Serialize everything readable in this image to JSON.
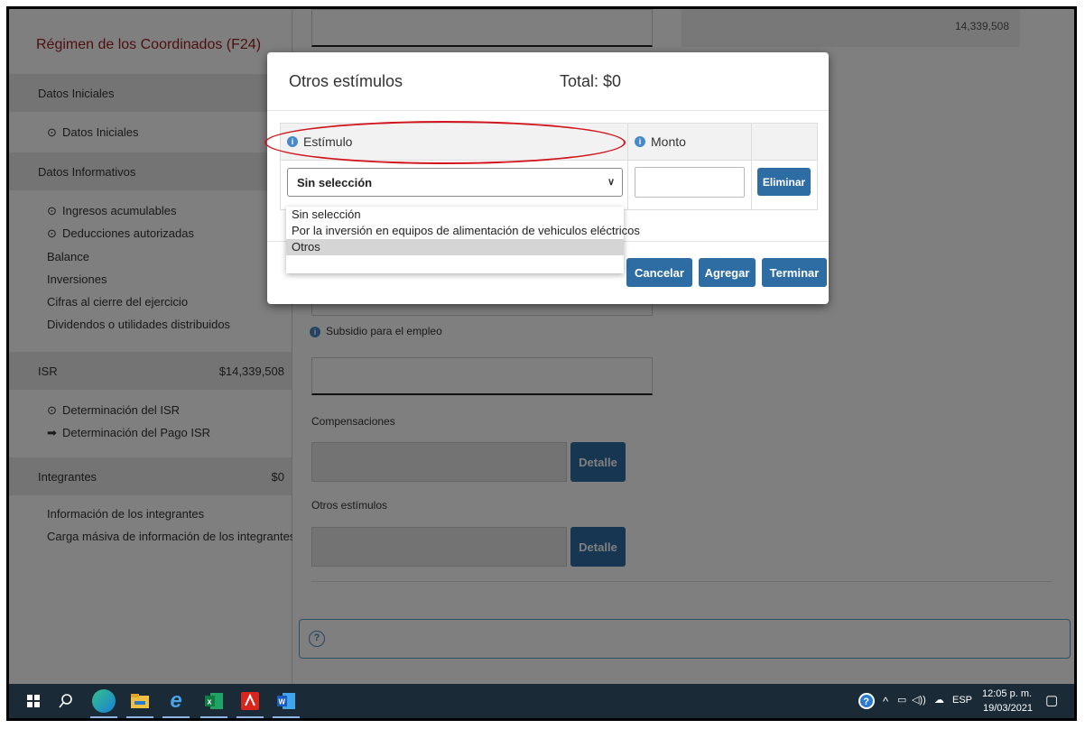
{
  "sidebar": {
    "title": "Régimen de los Coordinados (F24)",
    "sections": {
      "datos_iniciales": "Datos Iniciales",
      "datos_informativos": "Datos Informativos",
      "isr": "ISR",
      "isr_amount": "$14,339,508",
      "integrantes": "Integrantes",
      "integrantes_amount": "$0"
    },
    "items": {
      "datos_iniciales": "Datos Iniciales",
      "ingresos": "Ingresos acumulables",
      "deducciones": "Deducciones autorizadas",
      "balance": "Balance",
      "inversiones": "Inversiones",
      "cifras": "Cifras al cierre del ejercicio",
      "dividendos": "Dividendos o utilidades distribuidos",
      "det_isr": "Determinación del ISR",
      "det_pago": "Determinación del Pago ISR",
      "info_integrantes": "Información de los integrantes",
      "carga_masiva": "Carga másiva de información de los integrantes"
    }
  },
  "main": {
    "top_value": "14,339,508",
    "subsidio_label": "Subsidio para el empleo",
    "compensaciones_label": "Compensaciones",
    "otros_estimulos_label": "Otros estímulos",
    "detalle_label": "Detalle"
  },
  "modal": {
    "title": "Otros estímulos",
    "total": "Total: $0",
    "col_estimulo": "Estímulo",
    "col_monto": "Monto",
    "select_value": "Sin selección",
    "eliminar": "Eliminar",
    "options": [
      "Sin selección",
      "Por la inversión en equipos de alimentación de vehiculos eléctricos",
      "Otros"
    ],
    "selected_option_index": 2,
    "cancelar": "Cancelar",
    "agregar": "Agregar",
    "terminar": "Terminar"
  },
  "annotation": {
    "color": "#d2141c"
  },
  "taskbar": {
    "time": "12:05 p. m.",
    "date": "19/03/2021",
    "language": "ESP",
    "icons": [
      "windows-start-icon",
      "search-icon",
      "edge-icon",
      "file-explorer-icon",
      "internet-explorer-icon",
      "excel-icon",
      "acrobat-icon",
      "word-icon"
    ]
  },
  "colors": {
    "primary_button": "#2e6da4",
    "sidebar_title": "#9b1c1c",
    "taskbar": "#1a2a36"
  }
}
